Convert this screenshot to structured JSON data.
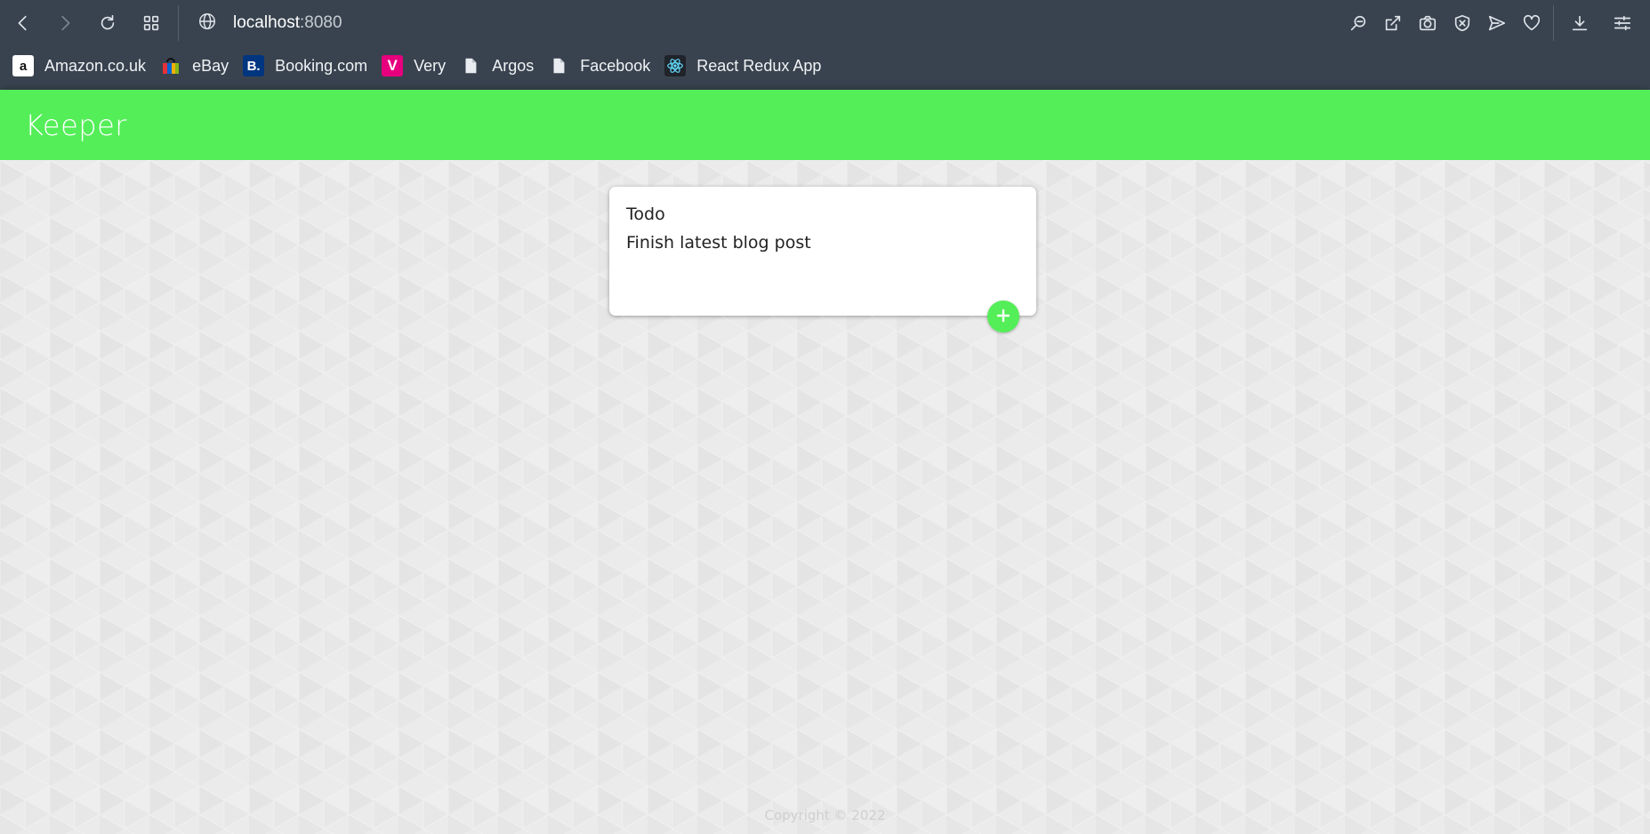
{
  "browser": {
    "url_host": "localhost",
    "url_port": ":8080",
    "toolbar_icons": [
      "back-icon",
      "forward-icon",
      "reload-icon",
      "tabs-grid-icon",
      "globe-icon",
      "zoom-icon",
      "edit-icon",
      "camera-icon",
      "shield-icon",
      "send-icon",
      "heart-icon",
      "download-icon",
      "settings-sliders-icon"
    ]
  },
  "bookmarks": [
    {
      "label": "Amazon.co.uk",
      "icon": "amazon-icon"
    },
    {
      "label": "eBay",
      "icon": "ebay-icon"
    },
    {
      "label": "Booking.com",
      "icon": "booking-icon"
    },
    {
      "label": "Very",
      "icon": "very-icon"
    },
    {
      "label": "Argos",
      "icon": "page-icon"
    },
    {
      "label": "Facebook",
      "icon": "page-icon"
    },
    {
      "label": "React Redux App",
      "icon": "react-icon"
    }
  ],
  "app": {
    "title": "Keeper",
    "accent": "#54ee58"
  },
  "note_form": {
    "title_value": "Todo",
    "content_value": "Finish latest blog post",
    "add_button_icon": "plus-icon"
  },
  "footer": {
    "copyright": "Copyright © 2022"
  }
}
